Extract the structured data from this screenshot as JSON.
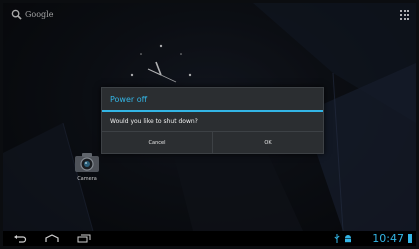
{
  "search": {
    "label": "Google"
  },
  "launcher": {
    "app_label": "Camera"
  },
  "dialog": {
    "title": "Power off",
    "message": "Would you like to shut down?",
    "cancel_label": "Cancel",
    "ok_label": "OK"
  },
  "status_bar": {
    "time": "10:47"
  },
  "colors": {
    "accent": "#33b5e5",
    "dialog_bg": "#2b2e31",
    "navbar": "#000000"
  },
  "icons": [
    "search-icon",
    "all-apps-icon",
    "camera-icon",
    "back-icon",
    "home-icon",
    "recent-apps-icon",
    "usb-icon",
    "android-debug-icon",
    "battery-icon"
  ]
}
